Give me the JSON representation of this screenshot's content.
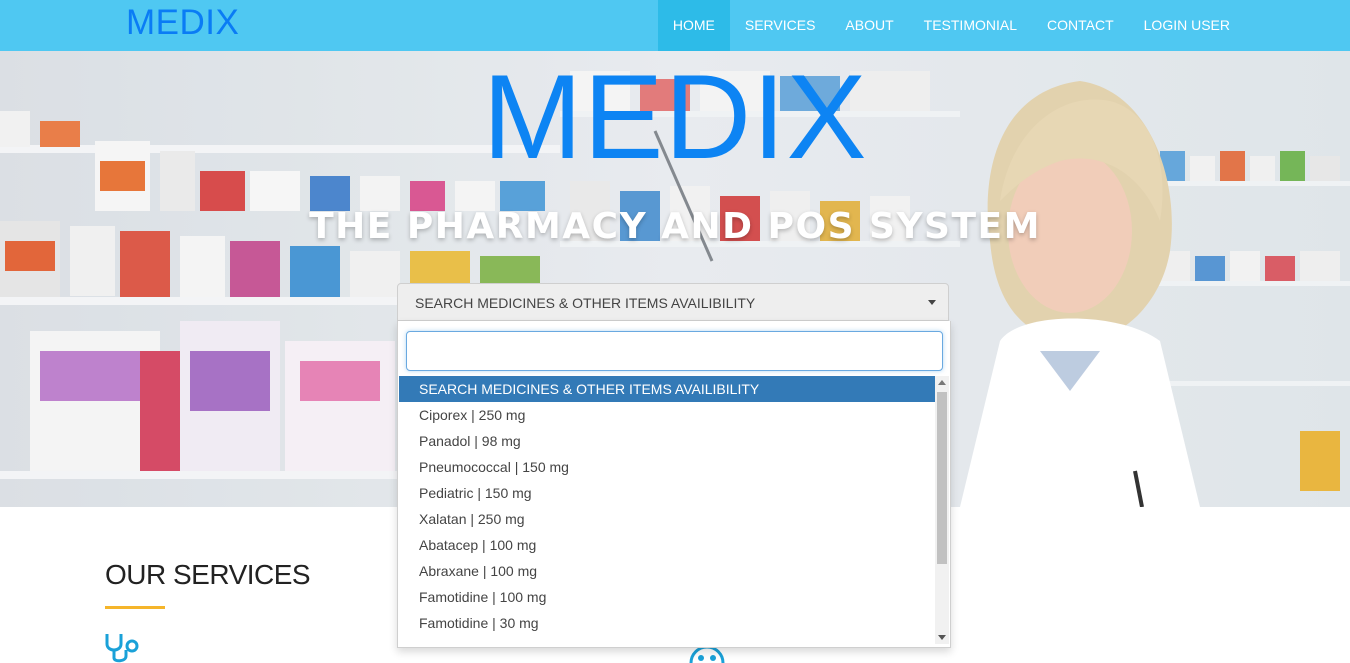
{
  "navbar": {
    "brand": "MEDIX",
    "items": [
      {
        "label": "HOME",
        "active": true
      },
      {
        "label": "SERVICES",
        "active": false
      },
      {
        "label": "ABOUT",
        "active": false
      },
      {
        "label": "TESTIMONIAL",
        "active": false
      },
      {
        "label": "CONTACT",
        "active": false
      },
      {
        "label": "LOGIN USER",
        "active": false
      }
    ]
  },
  "hero": {
    "title": "MEDIX",
    "subtitle": "THE PHARMACY AND POS SYSTEM"
  },
  "search": {
    "selected": "SEARCH MEDICINES & OTHER ITEMS AVAILIBILITY",
    "input_value": "",
    "options": [
      "SEARCH MEDICINES & OTHER ITEMS AVAILIBILITY",
      "Ciporex | 250 mg",
      "Panadol | 98 mg",
      "Pneumococcal | 150 mg",
      "Pediatric | 150 mg",
      "Xalatan | 250 mg",
      "Abatacep | 100 mg",
      "Abraxane | 100 mg",
      "Famotidine | 100 mg",
      "Famotidine | 30 mg"
    ]
  },
  "services": {
    "title": "OUR SERVICES"
  },
  "colors": {
    "navbar": "#4fc8f2",
    "brand": "#0a7cf5",
    "accent_underline": "#f5b52a",
    "highlight": "#337ab7"
  },
  "icons": [
    "stethoscope-icon",
    "medical-icon",
    "dropdown-arrow-icon"
  ]
}
